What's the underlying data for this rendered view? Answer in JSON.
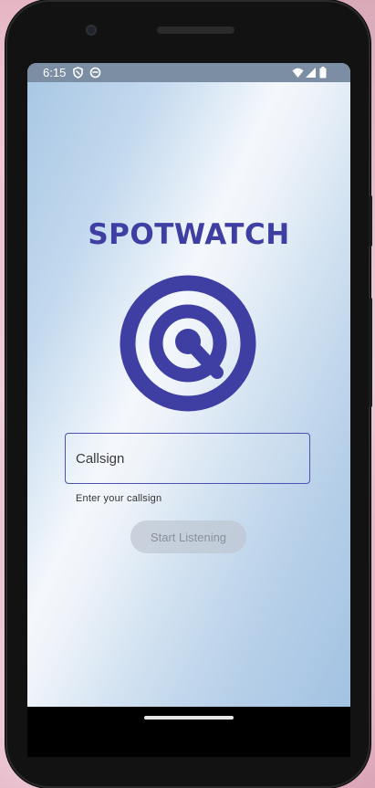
{
  "status_bar": {
    "time": "6:15",
    "icons": [
      "shield-icon",
      "vpn-icon",
      "wifi-icon",
      "cellular-signal-icon",
      "battery-icon"
    ]
  },
  "app": {
    "title": "SPOTWATCH",
    "logo_icon": "target-magnifier-icon",
    "brand_color": "#3f3fa3"
  },
  "callsign_field": {
    "placeholder": "Callsign",
    "value": "",
    "helper": "Enter your callsign"
  },
  "start_button": {
    "label": "Start Listening",
    "state": "disabled"
  }
}
